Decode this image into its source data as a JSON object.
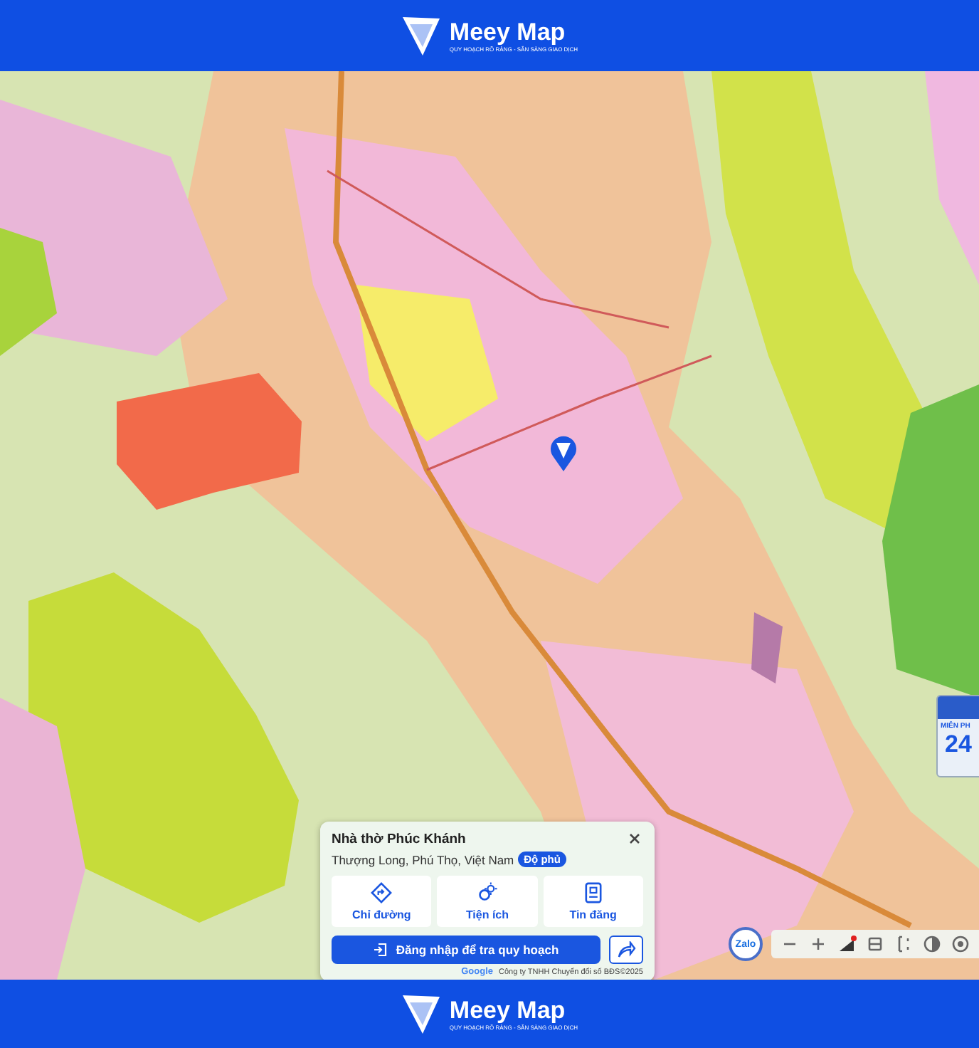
{
  "header": {
    "brand": "Meey Map",
    "tagline": "QUY HOẠCH RÕ RÀNG - SẴN SÀNG GIAO DỊCH"
  },
  "place_card": {
    "title": "Nhà thờ Phúc Khánh",
    "address": "Thượng Long, Phú Thọ, Việt Nam",
    "badge": "Độ phủ",
    "actions": [
      {
        "kind": "directions",
        "label": "Chỉ đường"
      },
      {
        "kind": "amenities",
        "label": "Tiện ích"
      },
      {
        "kind": "listings",
        "label": "Tin đăng"
      }
    ],
    "login_button": "Đăng nhập để tra quy hoạch"
  },
  "attribution": {
    "logo": "Google",
    "text": "Công ty TNHH Chuyển đổi số BĐS©2025"
  },
  "chat_button": "Zalo",
  "promo": {
    "label": "MIỄN PH",
    "value": "24"
  },
  "footer": {
    "brand": "Meey Map",
    "tagline": "QUY HOẠCH RÕ RÀNG - SẴN SÀNG GIAO DỊCH"
  }
}
